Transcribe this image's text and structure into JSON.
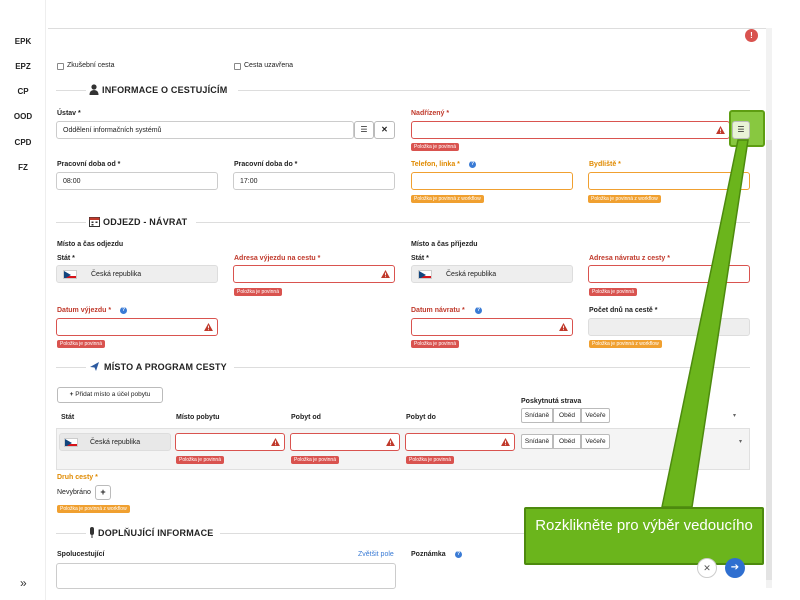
{
  "sidebar": {
    "items": [
      "EPK",
      "EPZ",
      "CP",
      "OOD",
      "CPD",
      "FZ"
    ],
    "expand_icon": "double-chevron-right-icon"
  },
  "top": {
    "alert_icon": "warning-circle-icon"
  },
  "checkboxes": {
    "trial_trip": "Zkušební cesta",
    "trip_closed": "Cesta uzavřena"
  },
  "traveler": {
    "section_title": "INFORMACE O CESTUJÍCÍM",
    "institution_label": "Ústav *",
    "institution_value": "Oddělení informačních systémů",
    "supervisor_label": "Nadřízený *",
    "supervisor_error": "Položka je povinná",
    "workday_from_label": "Pracovní doba od *",
    "workday_from_value": "08:00",
    "workday_to_label": "Pracovní doba do *",
    "workday_to_value": "17:00",
    "phone_label": "Telefon, linka *",
    "phone_warning": "Položka je povinná z workflow",
    "residence_label": "Bydliště *",
    "residence_warning": "Položka je povinná z workflow"
  },
  "departure": {
    "section_title": "ODJEZD - NÁVRAT",
    "departure_group": "Místo a čas odjezdu",
    "arrival_group": "Místo a čas příjezdu",
    "state_label": "Stát *",
    "state_value": "Česká republika",
    "depart_address_label": "Adresa výjezdu na cestu *",
    "return_address_label": "Adresa návratu z cesty *",
    "departure_date_label": "Datum výjezdu *",
    "return_date_label": "Datum návratu *",
    "days_label": "Počet dnů na cestě *",
    "error_text": "Položka je povinná",
    "workflow_text": "Položka je povinná z workflow"
  },
  "program": {
    "section_title": "MÍSTO A PROGRAM CESTY",
    "add_button": "Přidat místo a účel pobytu",
    "columns": {
      "state": "Stát",
      "place": "Místo pobytu",
      "from": "Pobyt od",
      "to": "Pobyt do",
      "meals": "Poskytnutá strava"
    },
    "meal_options": [
      "Snídaně",
      "Oběd",
      "Večeře"
    ],
    "row_state": "Česká republika",
    "error_text": "Položka je povinná",
    "trip_type_label": "Druh cesty *",
    "trip_type_value": "Nevybráno",
    "trip_type_warning": "Položka je povinná z workflow"
  },
  "additional": {
    "section_title": "DOPLŇUJÍCÍ INFORMACE",
    "companions_label": "Spolucestující",
    "enlarge_link": "Zvětšit pole",
    "note_label": "Poznámka"
  },
  "callout": {
    "text": "Rozklikněte pro výběr vedoucího"
  },
  "colors": {
    "error": "#d9534f",
    "warning": "#f0a030",
    "callout": "#6bb51c",
    "link": "#3a7bd5"
  }
}
